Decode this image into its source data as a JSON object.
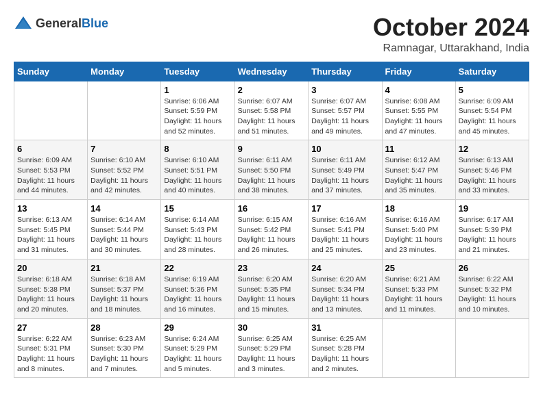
{
  "header": {
    "logo_general": "General",
    "logo_blue": "Blue",
    "title": "October 2024",
    "location": "Ramnagar, Uttarakhand, India"
  },
  "days_of_week": [
    "Sunday",
    "Monday",
    "Tuesday",
    "Wednesday",
    "Thursday",
    "Friday",
    "Saturday"
  ],
  "weeks": [
    [
      {
        "day": "",
        "info": ""
      },
      {
        "day": "",
        "info": ""
      },
      {
        "day": "1",
        "info": "Sunrise: 6:06 AM\nSunset: 5:59 PM\nDaylight: 11 hours and 52 minutes."
      },
      {
        "day": "2",
        "info": "Sunrise: 6:07 AM\nSunset: 5:58 PM\nDaylight: 11 hours and 51 minutes."
      },
      {
        "day": "3",
        "info": "Sunrise: 6:07 AM\nSunset: 5:57 PM\nDaylight: 11 hours and 49 minutes."
      },
      {
        "day": "4",
        "info": "Sunrise: 6:08 AM\nSunset: 5:55 PM\nDaylight: 11 hours and 47 minutes."
      },
      {
        "day": "5",
        "info": "Sunrise: 6:09 AM\nSunset: 5:54 PM\nDaylight: 11 hours and 45 minutes."
      }
    ],
    [
      {
        "day": "6",
        "info": "Sunrise: 6:09 AM\nSunset: 5:53 PM\nDaylight: 11 hours and 44 minutes."
      },
      {
        "day": "7",
        "info": "Sunrise: 6:10 AM\nSunset: 5:52 PM\nDaylight: 11 hours and 42 minutes."
      },
      {
        "day": "8",
        "info": "Sunrise: 6:10 AM\nSunset: 5:51 PM\nDaylight: 11 hours and 40 minutes."
      },
      {
        "day": "9",
        "info": "Sunrise: 6:11 AM\nSunset: 5:50 PM\nDaylight: 11 hours and 38 minutes."
      },
      {
        "day": "10",
        "info": "Sunrise: 6:11 AM\nSunset: 5:49 PM\nDaylight: 11 hours and 37 minutes."
      },
      {
        "day": "11",
        "info": "Sunrise: 6:12 AM\nSunset: 5:47 PM\nDaylight: 11 hours and 35 minutes."
      },
      {
        "day": "12",
        "info": "Sunrise: 6:13 AM\nSunset: 5:46 PM\nDaylight: 11 hours and 33 minutes."
      }
    ],
    [
      {
        "day": "13",
        "info": "Sunrise: 6:13 AM\nSunset: 5:45 PM\nDaylight: 11 hours and 31 minutes."
      },
      {
        "day": "14",
        "info": "Sunrise: 6:14 AM\nSunset: 5:44 PM\nDaylight: 11 hours and 30 minutes."
      },
      {
        "day": "15",
        "info": "Sunrise: 6:14 AM\nSunset: 5:43 PM\nDaylight: 11 hours and 28 minutes."
      },
      {
        "day": "16",
        "info": "Sunrise: 6:15 AM\nSunset: 5:42 PM\nDaylight: 11 hours and 26 minutes."
      },
      {
        "day": "17",
        "info": "Sunrise: 6:16 AM\nSunset: 5:41 PM\nDaylight: 11 hours and 25 minutes."
      },
      {
        "day": "18",
        "info": "Sunrise: 6:16 AM\nSunset: 5:40 PM\nDaylight: 11 hours and 23 minutes."
      },
      {
        "day": "19",
        "info": "Sunrise: 6:17 AM\nSunset: 5:39 PM\nDaylight: 11 hours and 21 minutes."
      }
    ],
    [
      {
        "day": "20",
        "info": "Sunrise: 6:18 AM\nSunset: 5:38 PM\nDaylight: 11 hours and 20 minutes."
      },
      {
        "day": "21",
        "info": "Sunrise: 6:18 AM\nSunset: 5:37 PM\nDaylight: 11 hours and 18 minutes."
      },
      {
        "day": "22",
        "info": "Sunrise: 6:19 AM\nSunset: 5:36 PM\nDaylight: 11 hours and 16 minutes."
      },
      {
        "day": "23",
        "info": "Sunrise: 6:20 AM\nSunset: 5:35 PM\nDaylight: 11 hours and 15 minutes."
      },
      {
        "day": "24",
        "info": "Sunrise: 6:20 AM\nSunset: 5:34 PM\nDaylight: 11 hours and 13 minutes."
      },
      {
        "day": "25",
        "info": "Sunrise: 6:21 AM\nSunset: 5:33 PM\nDaylight: 11 hours and 11 minutes."
      },
      {
        "day": "26",
        "info": "Sunrise: 6:22 AM\nSunset: 5:32 PM\nDaylight: 11 hours and 10 minutes."
      }
    ],
    [
      {
        "day": "27",
        "info": "Sunrise: 6:22 AM\nSunset: 5:31 PM\nDaylight: 11 hours and 8 minutes."
      },
      {
        "day": "28",
        "info": "Sunrise: 6:23 AM\nSunset: 5:30 PM\nDaylight: 11 hours and 7 minutes."
      },
      {
        "day": "29",
        "info": "Sunrise: 6:24 AM\nSunset: 5:29 PM\nDaylight: 11 hours and 5 minutes."
      },
      {
        "day": "30",
        "info": "Sunrise: 6:25 AM\nSunset: 5:29 PM\nDaylight: 11 hours and 3 minutes."
      },
      {
        "day": "31",
        "info": "Sunrise: 6:25 AM\nSunset: 5:28 PM\nDaylight: 11 hours and 2 minutes."
      },
      {
        "day": "",
        "info": ""
      },
      {
        "day": "",
        "info": ""
      }
    ]
  ]
}
